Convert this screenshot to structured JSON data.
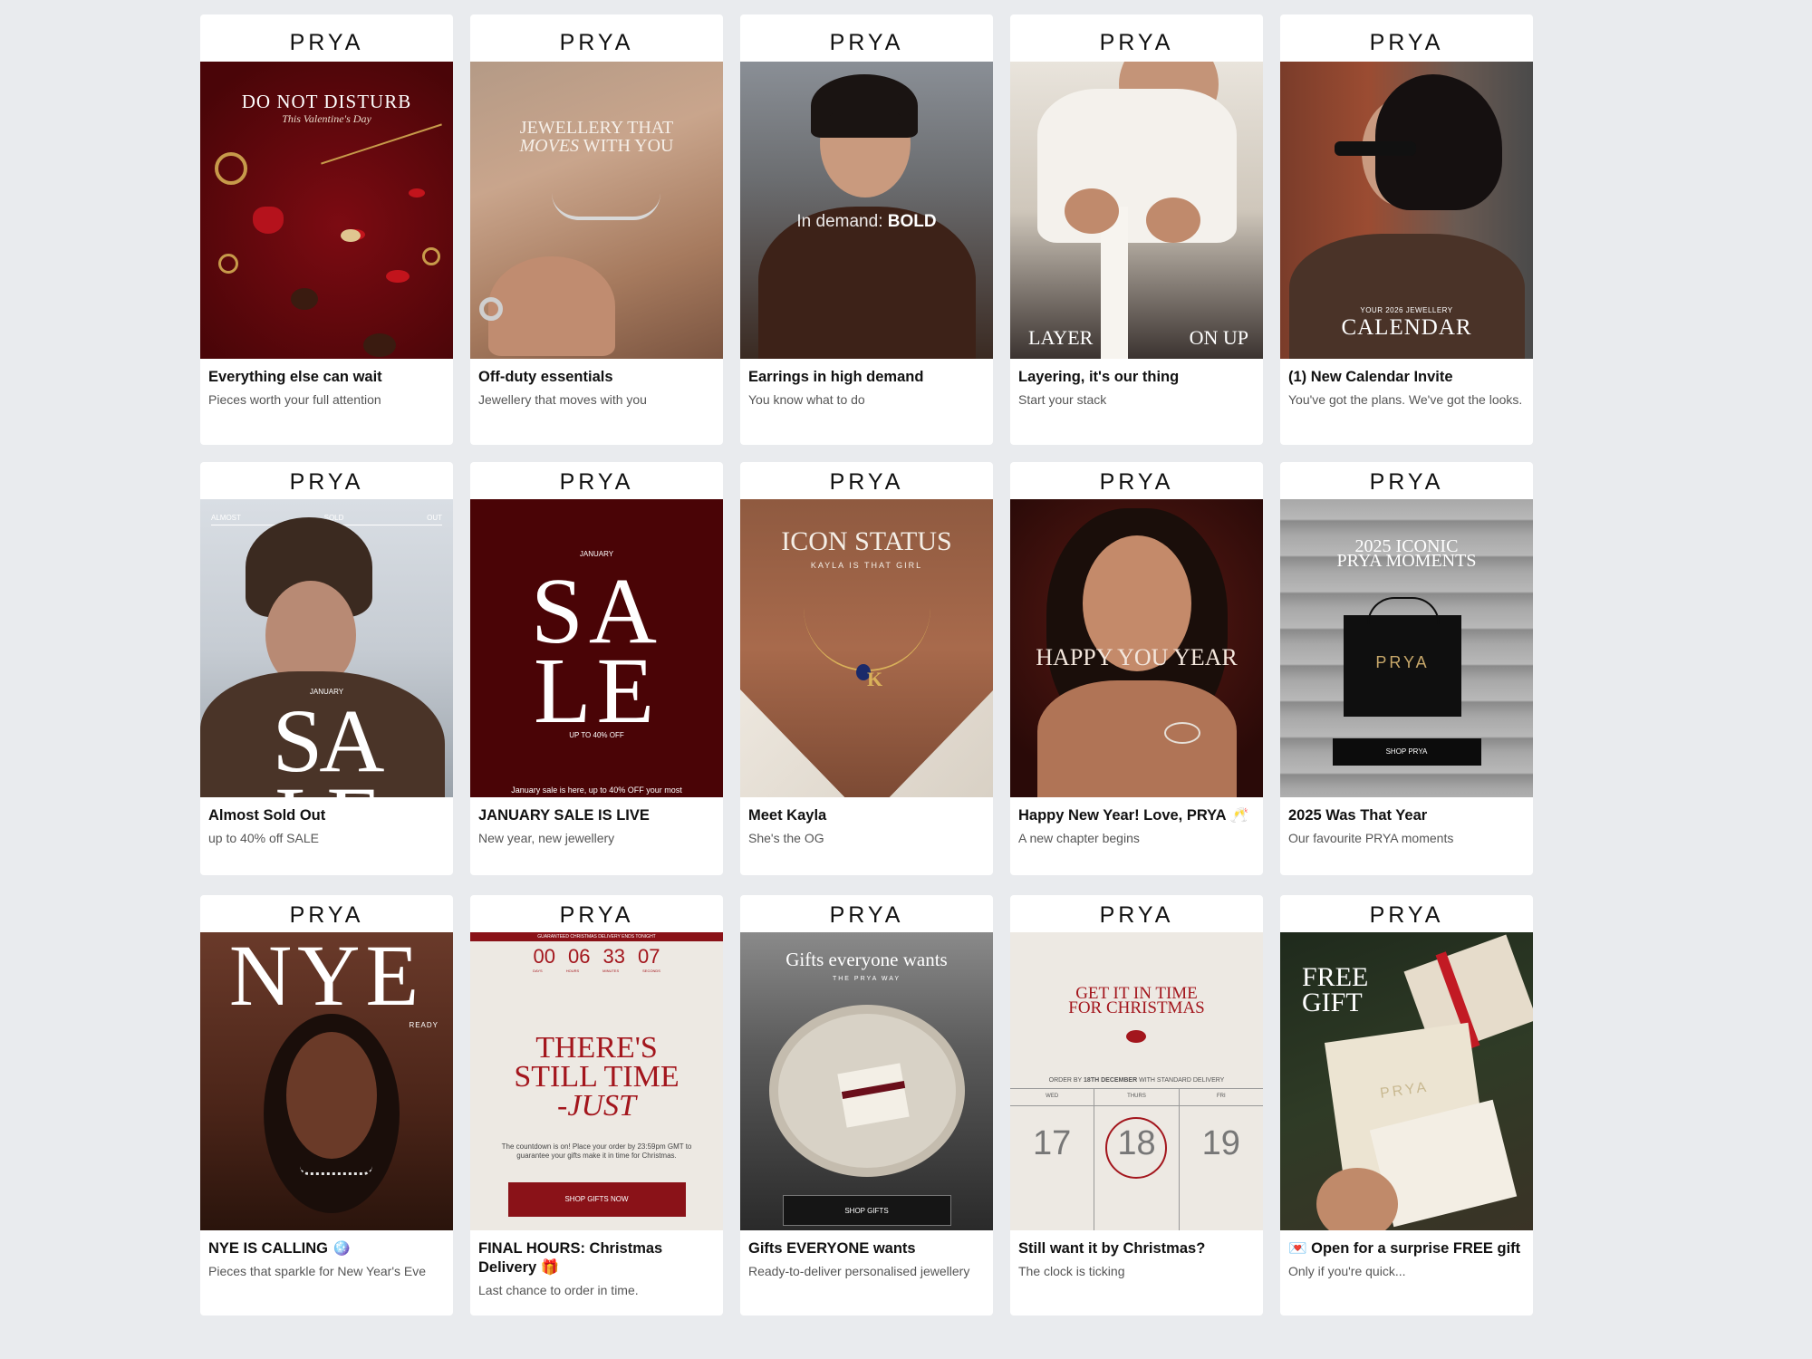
{
  "brand": "PRYA",
  "cards": [
    {
      "title": "Everything else can wait",
      "sub": "Pieces worth your full attention",
      "img": {
        "headline": "DO NOT DISTURB",
        "tag": "This Valentine's Day"
      }
    },
    {
      "title": "Off-duty essentials",
      "sub": "Jewellery that moves with you",
      "img": {
        "line1": "JEWELLERY THAT",
        "line2a": "MOVES",
        "line2b": " WITH YOU"
      }
    },
    {
      "title": "Earrings in high demand",
      "sub": "You know what to do",
      "img": {
        "thin": "In demand:",
        "bold": "BOLD"
      }
    },
    {
      "title": "Layering, it's our thing",
      "sub": "Start your stack",
      "img": {
        "left": "LAYER",
        "right": "ON UP"
      }
    },
    {
      "title": "(1) New Calendar Invite",
      "sub": "You've got the plans. We've got the looks.",
      "img": {
        "small": "YOUR 2026 JEWELLERY",
        "big": "CALENDAR"
      }
    },
    {
      "title": "Almost Sold Out",
      "sub": "up to 40% off SALE",
      "img": {
        "t1": "ALMOST",
        "t2": "SOLD",
        "t3": "OUT",
        "month": "JANUARY",
        "big": "SA",
        "big2": "LE"
      }
    },
    {
      "title": "JANUARY SALE IS LIVE",
      "sub": "New year, new jewellery",
      "img": {
        "month": "JANUARY",
        "big1": "SA",
        "big2": "LE",
        "small": "UP TO 40% OFF",
        "foot": "January sale is here, up to 40% OFF your most"
      }
    },
    {
      "title": "Meet Kayla",
      "sub": "She's the OG",
      "img": {
        "headline": "ICON STATUS",
        "tag": "KAYLA IS THAT GIRL",
        "pendant": "K"
      }
    },
    {
      "title": "Happy New Year! Love, PRYA 🥂",
      "sub": "A new chapter begins",
      "img": {
        "headline": "HAPPY YOU YEAR"
      }
    },
    {
      "title": "2025 Was That Year",
      "sub": "Our favourite PRYA moments",
      "img": {
        "l1": "2025 ICONIC",
        "l2": "PRYA MOMENTS",
        "bag": "PRYA",
        "btn": "SHOP PRYA"
      }
    },
    {
      "title": "NYE IS CALLING 🪩",
      "sub": "Pieces that sparkle for New Year's Eve",
      "img": {
        "big": "NYE",
        "ready": "READY"
      }
    },
    {
      "title": "FINAL HOURS: Christmas Delivery 🎁",
      "sub": "Last chance to order in time.",
      "img": {
        "banner": "GUARANTEED CHRISTMAS DELIVERY ENDS TONIGHT",
        "d": "00",
        "h": "06",
        "m": "33",
        "s": "07",
        "dl": "DAYS",
        "hl": "HOURS",
        "ml": "MINUTES",
        "sl": "SECONDS",
        "l1": "THERE'S",
        "l2": "STILL TIME",
        "l3": "-JUST",
        "body": "The countdown is on! Place your order by 23:59pm GMT to guarantee your gifts make it in time for Christmas.",
        "btn": "SHOP GIFTS NOW"
      }
    },
    {
      "title": "Gifts EVERYONE wants",
      "sub": "Ready-to-deliver personalised jewellery",
      "img": {
        "headline": "Gifts everyone wants",
        "tag": "THE PRYA WAY",
        "btn": "SHOP GIFTS"
      }
    },
    {
      "title": "Still want it by Christmas?",
      "sub": "The clock is ticking",
      "img": {
        "l1": "GET IT IN TIME",
        "l2": "FOR CHRISTMAS",
        "order_pre": "ORDER BY ",
        "order_bold": "18TH DECEMBER",
        "order_post": " WITH STANDARD DELIVERY",
        "d1": "WED",
        "d2": "THURS",
        "d3": "FRI",
        "n1": "17",
        "n2": "18",
        "n3": "19"
      }
    },
    {
      "title": "💌 Open for a surprise FREE gift",
      "sub": "Only if you're quick...",
      "img": {
        "l1": "FREE",
        "l2": "GIFT",
        "box": "PRYA"
      }
    }
  ],
  "colors": {
    "page": "#e9ebee",
    "card": "#ffffff",
    "wine": "#5a0a0f",
    "sale": "#4a0406",
    "red": "#a3161d"
  }
}
